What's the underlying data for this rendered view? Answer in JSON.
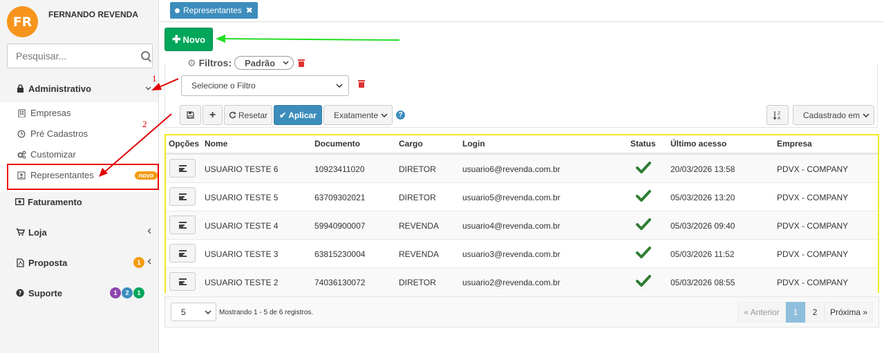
{
  "sidebar": {
    "avatar_initials": "FR",
    "user_name": "FERNANDO REVENDA",
    "search_placeholder": "Pesquisar...",
    "menu": [
      {
        "label": "Administrativo"
      },
      {
        "label": "Faturamento"
      },
      {
        "label": "Loja"
      },
      {
        "label": "Proposta",
        "badges": [
          "1"
        ]
      },
      {
        "label": "Suporte",
        "badges": [
          "1",
          "2",
          "1"
        ]
      }
    ],
    "submenu": [
      {
        "label": "Empresas"
      },
      {
        "label": "Pré Cadastros"
      },
      {
        "label": "Customizar"
      },
      {
        "label": "Representantes",
        "badge": "novo"
      }
    ]
  },
  "tabs": [
    {
      "label": "Representantes"
    }
  ],
  "toolbar": {
    "novo_label": "Novo",
    "filters_label": "Filtros:",
    "preset_value": "Padrão",
    "filter_select_value": "Selecione o Filtro",
    "reset_label": "Resetar",
    "apply_label": "Aplicar",
    "match_value": "Exatamente",
    "sort_value": "Cadastrado em"
  },
  "table": {
    "headers": [
      "Opções",
      "Nome",
      "Documento",
      "Cargo",
      "Login",
      "Status",
      "Último acesso",
      "Empresa"
    ],
    "rows": [
      {
        "nome": "USUARIO TESTE 6",
        "documento": "10923411020",
        "cargo": "DIRETOR",
        "login": "usuario6@revenda.com.br",
        "ultimo": "20/03/2026 13:58",
        "empresa": "PDVX - COMPANY"
      },
      {
        "nome": "USUARIO TESTE 5",
        "documento": "63709302021",
        "cargo": "DIRETOR",
        "login": "usuario5@revenda.com.br",
        "ultimo": "05/03/2026 13:20",
        "empresa": "PDVX - COMPANY"
      },
      {
        "nome": "USUARIO TESTE 4",
        "documento": "59940900007",
        "cargo": "REVENDA",
        "login": "usuario4@revenda.com.br",
        "ultimo": "05/03/2026 09:40",
        "empresa": "PDVX - COMPANY"
      },
      {
        "nome": "USUARIO TESTE 3",
        "documento": "63815230004",
        "cargo": "REVENDA",
        "login": "usuario3@revenda.com.br",
        "ultimo": "05/03/2026 11:52",
        "empresa": "PDVX - COMPANY"
      },
      {
        "nome": "USUARIO TESTE 2",
        "documento": "74036130072",
        "cargo": "DIRETOR",
        "login": "usuario2@revenda.com.br",
        "ultimo": "05/03/2026 08:55",
        "empresa": "PDVX - COMPANY"
      }
    ]
  },
  "pager": {
    "page_size": "5",
    "showing": "Mostrando 1 - 5 de 6 registros.",
    "prev_label": "« Anterior",
    "pages": [
      "1",
      "2"
    ],
    "next_label": "Próxima »"
  },
  "annotations": {
    "step1": "1",
    "step2": "2"
  },
  "colors": {
    "primary": "#3c8dbc",
    "success": "#00a65a",
    "novo_badge": "#f39c12",
    "highlight": "#f2e81d",
    "annotation": "#e00000",
    "arrow_green": "#22dd22"
  }
}
